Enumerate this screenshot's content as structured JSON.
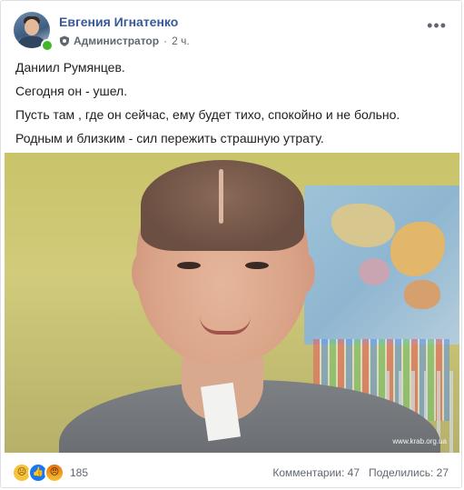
{
  "post": {
    "author": "Евгения Игнатенко",
    "role": "Администратор",
    "time": "2 ч.",
    "separator": "·",
    "more_icon": "more-options-icon",
    "role_icon": "shield-icon",
    "lines": [
      "Даниил Румянцев.",
      "Сегодня он - ушел.",
      "Пусть там , где он сейчас, ему будет тихо, спокойно и не больно.",
      "Родным и близким - сил пережить страшную утрату."
    ],
    "photo": {
      "watermark": "www.krab.org.ua"
    }
  },
  "footer": {
    "reactions": [
      "sad-reaction-icon",
      "like-reaction-icon",
      "angry-reaction-icon"
    ],
    "reaction_count": "185",
    "comments": "Комментарии: 47",
    "shares": "Поделились: 27"
  },
  "colors": {
    "author_link": "#385898",
    "meta_text": "#606770",
    "online": "#42b72a",
    "like": "#1877f2"
  }
}
